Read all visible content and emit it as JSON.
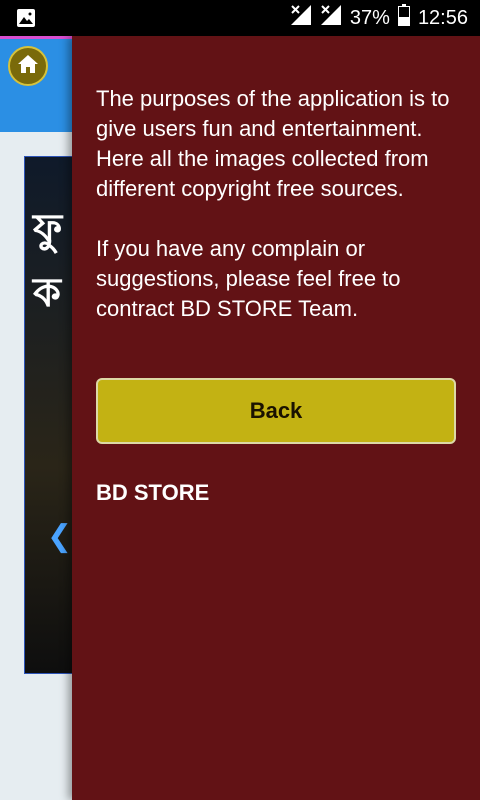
{
  "status_bar": {
    "battery_percent": "37%",
    "time": "12:56",
    "icons": [
      "image-notification-icon",
      "signal-icon",
      "signal-icon",
      "battery-icon"
    ]
  },
  "background": {
    "slider_text_line1": "ফু",
    "slider_text_line2": "ক",
    "prev_arrow": "❮"
  },
  "drawer": {
    "description": "The purposes of the application is to give users fun and entertainment. Here all the images collected from different copyright free sources.\n\nIf you have any complain or suggestions, please feel free to contract BD STORE Team.",
    "back_label": "Back",
    "brand": "BD STORE"
  },
  "colors": {
    "drawer_bg": "#621215",
    "button_bg": "#c3b213",
    "header_bg": "#2b8fe4"
  }
}
